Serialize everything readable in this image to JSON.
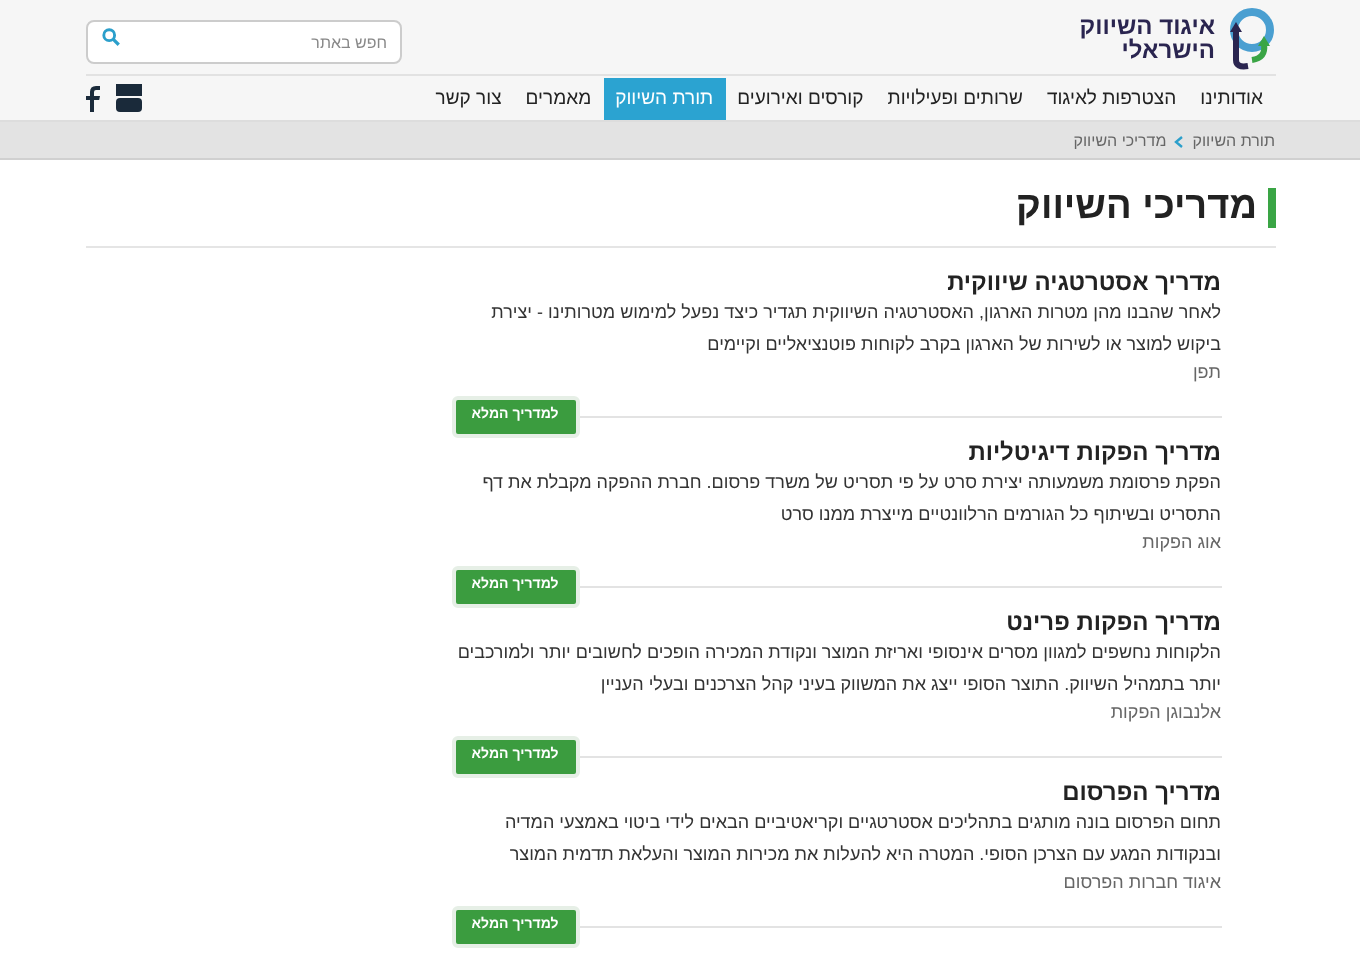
{
  "logo": {
    "line_1": "איגוד השיווק",
    "line_2": "הישראלי"
  },
  "search": {
    "placeholder": "חפש באתר"
  },
  "nav": [
    {
      "label": "אודותינו",
      "selected": false
    },
    {
      "label": "הצטרפות לאיגוד",
      "selected": false
    },
    {
      "label": "שרותים ופעילויות",
      "selected": false
    },
    {
      "label": "קורסים ואירועים",
      "selected": false
    },
    {
      "label": "תורת השיווק",
      "selected": true
    },
    {
      "label": "מאמרים",
      "selected": false
    },
    {
      "label": "צור קשר",
      "selected": false
    }
  ],
  "breadcrumb": [
    "תורת השיווק",
    "מדריכי השיווק"
  ],
  "page_title": "מדריכי השיווק",
  "guides": [
    {
      "title": "מדריך אסטרטגיה שיווקית",
      "text": "לאחר שהבנו מהן מטרות הארגון, האסטרטגיה השיווקית תגדיר כיצד נפעל למימוש מטרותינו - יצירת ביקוש למוצר או לשירות של הארגון בקרב לקוחות פוטנציאליים וקיימים",
      "source": "תפן",
      "button": "למדריך המלא"
    },
    {
      "title": "מדריך הפקות דיגיטליות",
      "text": "הפקת פרסומת משמעותה יצירת סרט על פי תסריט של משרד פרסום. חברת ההפקה מקבלת את דף התסריט ובשיתוף כל הגורמים הרלוונטיים מייצרת ממנו סרט",
      "source": "אוג הפקות",
      "button": "למדריך המלא"
    },
    {
      "title": "מדריך הפקות פרינט",
      "text": "הלקוחות נחשפים למגוון מסרים אינסופי ואריזת המוצר ונקודת המכירה הופכים לחשובים יותר ולמורכבים יותר בתמהיל השיווק. התוצר הסופי ייצג את המשווק בעיני קהל הצרכנים ובעלי העניין",
      "source": "אלנבוגן הפקות",
      "button": "למדריך המלא"
    },
    {
      "title": "מדריך הפרסום",
      "text": "תחום הפרסום בונה מותגים בתהליכים אסטרטגיים וקריאטיביים הבאים לידי ביטוי באמצעי המדיה ובנקודות המגע עם הצרכן הסופי. המטרה היא להעלות את מכירות המוצר והעלאת תדמית המוצר",
      "source": "איגוד חברות הפרסום",
      "button": "למדריך המלא"
    }
  ]
}
